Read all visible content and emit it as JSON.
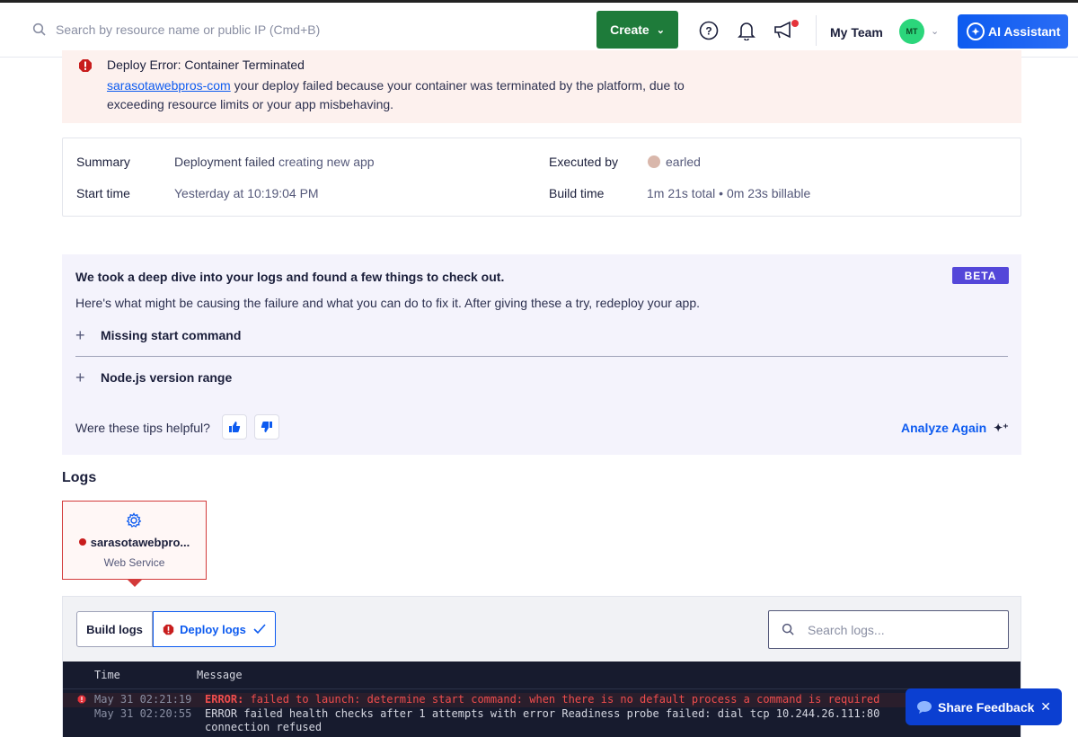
{
  "header": {
    "search_placeholder": "Search by resource name or public IP (Cmd+B)",
    "create_label": "Create",
    "team_label": "My Team",
    "avatar_initials": "MT",
    "ai_assistant_label": "AI Assistant"
  },
  "error_banner": {
    "title": "Deploy Error: Container Terminated",
    "link_text": "sarasotawebpros-com",
    "body": " your deploy failed because your container was terminated by the platform, due to exceeding resource limits or your app misbehaving."
  },
  "summary": {
    "summary_label": "Summary",
    "summary_value_bold": "Deployment failed",
    "summary_value_rest": " creating new app",
    "start_time_label": "Start time",
    "start_time_value": "Yesterday at 10:19:04 PM",
    "executed_by_label": "Executed by",
    "executed_by_value": "earled",
    "build_time_label": "Build time",
    "build_time_value": "1m 21s total • 0m 23s billable"
  },
  "insights": {
    "title": "We took a deep dive into your logs and found a few things to check out.",
    "badge": "BETA",
    "subtitle": "Here's what might be causing the failure and what you can do to fix it. After giving these a try, redeploy your app.",
    "tips": [
      "Missing start command",
      "Node.js version range"
    ],
    "helpful_question": "Were these tips helpful?",
    "analyze_label": "Analyze Again"
  },
  "logs": {
    "title": "Logs",
    "service": {
      "name": "sarasotawebpro...",
      "type": "Web Service"
    },
    "tabs": {
      "build": "Build logs",
      "deploy": "Deploy logs"
    },
    "search_placeholder": "Search logs...",
    "columns": {
      "time": "Time",
      "message": "Message"
    },
    "rows": [
      {
        "time": "May 31 02:21:19",
        "level": "ERROR:",
        "message": " failed to launch: determine start command: when there is no default process a command is required"
      },
      {
        "time": "May 31 02:20:55",
        "message": "ERROR failed health checks after 1 attempts with error Readiness probe failed: dial tcp 10.244.26.111:80"
      },
      {
        "time": "",
        "message": "connection refused"
      }
    ]
  },
  "feedback": {
    "label": "Share Feedback"
  },
  "colors": {
    "primary": "#0d5bf0",
    "create_green": "#1e7b3a",
    "error_red": "#c81d1d",
    "beta_purple": "#5447d9"
  }
}
